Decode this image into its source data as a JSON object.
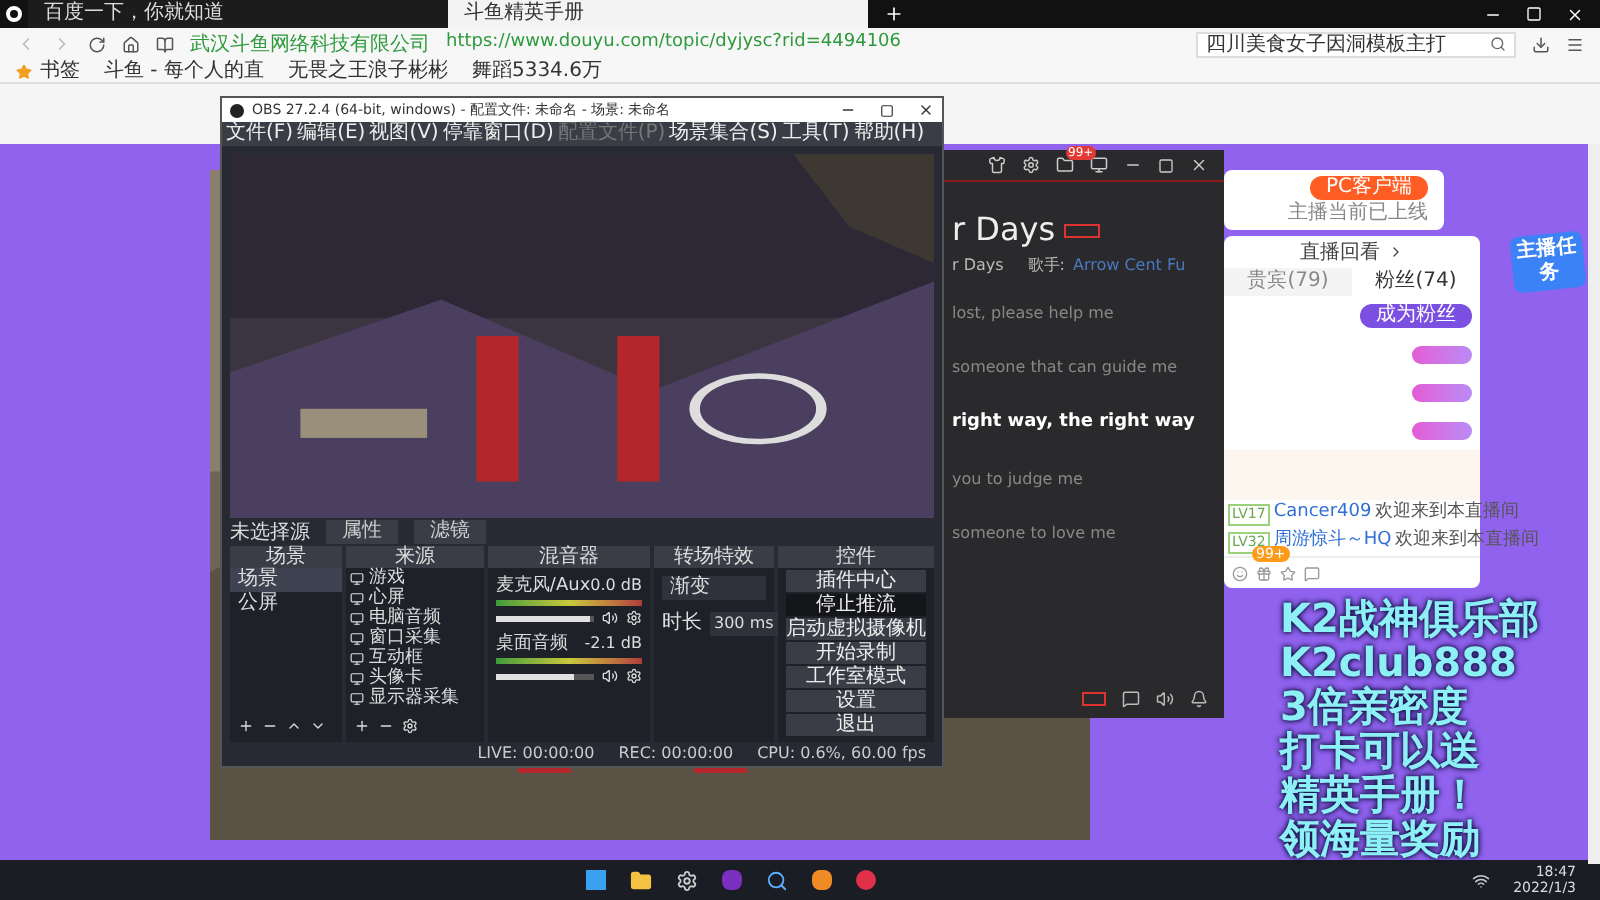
{
  "browser": {
    "tabs": [
      {
        "title": "百度一下，你就知道",
        "selected": false
      },
      {
        "title": "斗鱼精英手册",
        "selected": true
      }
    ],
    "site_name": "武汉斗鱼网络科技有限公司",
    "url": "https://www.douyu.com/topic/dyjysc?rid=4494106",
    "search": {
      "value": "四川美食女子因洞模板主打"
    },
    "bookmarks": [
      "书签",
      "斗鱼 - 每个人的直",
      "无畏之王浪子彬彬",
      "舞蹈5334.6万"
    ]
  },
  "obs": {
    "title": "OBS 27.2.4 (64-bit, windows) - 配置文件: 未命名 - 场景: 未命名",
    "menu": [
      {
        "label": "文件(F)",
        "disabled": false
      },
      {
        "label": "编辑(E)",
        "disabled": false
      },
      {
        "label": "视图(V)",
        "disabled": false
      },
      {
        "label": "停靠窗口(D)",
        "disabled": false
      },
      {
        "label": "配置文件(P)",
        "disabled": true
      },
      {
        "label": "场景集合(S)",
        "disabled": false
      },
      {
        "label": "工具(T)",
        "disabled": false
      },
      {
        "label": "帮助(H)",
        "disabled": false
      }
    ],
    "source_status": "未选择源",
    "source_buttons": [
      "属性",
      "滤镜"
    ],
    "scenes": {
      "title": "场景",
      "items": [
        {
          "label": "场景",
          "selected": true
        },
        {
          "label": "公屏",
          "selected": false
        }
      ]
    },
    "sources": {
      "title": "来源",
      "items": [
        "游戏",
        "心屏",
        "电脑音频",
        "窗口采集",
        "互动框",
        "头像卡",
        "显示器采集"
      ]
    },
    "mixer": {
      "title": "混音器",
      "channels": [
        {
          "name": "麦克风/Aux",
          "reading": "0.0 dB",
          "level": 0.95
        },
        {
          "name": "桌面音频",
          "reading": "-2.1 dB",
          "level": 0.8
        }
      ]
    },
    "transitions": {
      "title": "转场特效",
      "value": "渐变",
      "duration_label": "时长",
      "duration": "300 ms"
    },
    "controls": {
      "title": "控件",
      "buttons": [
        {
          "label": "插件中心",
          "active": false
        },
        {
          "label": "停止推流",
          "active": true
        },
        {
          "label": "启动虚拟摄像机",
          "active": false
        },
        {
          "label": "开始录制",
          "active": false
        },
        {
          "label": "工作室模式",
          "active": false
        },
        {
          "label": "设置",
          "active": false
        },
        {
          "label": "退出",
          "active": false
        }
      ]
    },
    "status": [
      "LIVE: 00:00:00",
      "REC: 00:00:00",
      "CPU: 0.6%, 60.00 fps"
    ]
  },
  "player": {
    "badge": "99+",
    "title": "r Days",
    "subtitle": "r Days",
    "artist_label": "歌手:",
    "artist": "Arrow Cent Fu",
    "lyrics": [
      {
        "text": "lost, please help me",
        "current": false
      },
      {
        "text": "someone that can guide me",
        "current": false
      },
      {
        "text": "right way, the right way",
        "current": true
      },
      {
        "text": "you to judge me",
        "current": false
      },
      {
        "text": "someone to love me",
        "current": false
      }
    ]
  },
  "douyu": {
    "client_button": "PC客户端",
    "online_note": "主播当前已上线",
    "replay": "直播回看",
    "tabs": [
      {
        "label": "贵宾(79)",
        "selected": false
      },
      {
        "label": "粉丝(74)",
        "selected": true
      }
    ],
    "fan_button": "成为粉丝",
    "chat": [
      {
        "level": "LV17",
        "name": "Cancer409",
        "message": "欢迎来到本直播间"
      },
      {
        "level": "LV32",
        "name": "周游惊斗～HQ",
        "message": "欢迎来到本直播间"
      }
    ],
    "toolbar_badge": "99+",
    "task_badge": "主播任务"
  },
  "overlay": [
    "K2战神俱乐部",
    "K2club888",
    "3倍亲密度",
    "打卡可以送",
    "精英手册！",
    "领海量奖励"
  ],
  "taskbar": {
    "time": "18:47",
    "date": "2022/1/3"
  }
}
